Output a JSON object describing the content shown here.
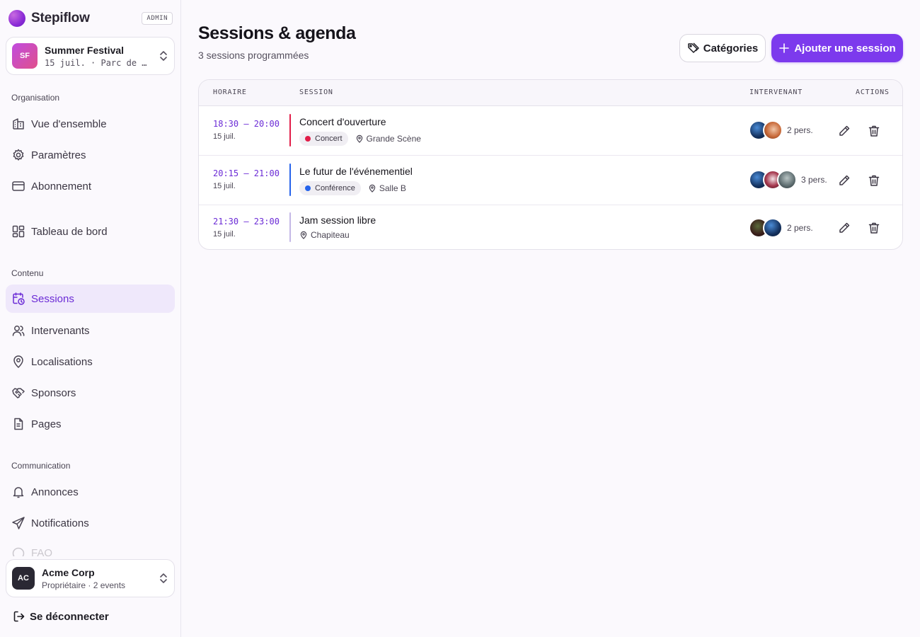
{
  "brand": {
    "name": "Stepiflow",
    "badge": "ADMIN"
  },
  "event": {
    "initials": "SF",
    "name": "Summer Festival",
    "subtitle": "15 juil. · Parc de …"
  },
  "nav": {
    "sections": {
      "organisation": "Organisation",
      "contenu": "Contenu",
      "communication": "Communication"
    },
    "items": {
      "overview": "Vue d'ensemble",
      "settings": "Paramètres",
      "subscription": "Abonnement",
      "dashboard": "Tableau de bord",
      "sessions": "Sessions",
      "speakers": "Intervenants",
      "locations": "Localisations",
      "sponsors": "Sponsors",
      "pages": "Pages",
      "announcements": "Annonces",
      "notifications": "Notifications",
      "faq": "FAQ"
    }
  },
  "org": {
    "initials": "AC",
    "name": "Acme Corp",
    "subtitle": "Propriétaire · 2 events"
  },
  "logout_label": "Se déconnecter",
  "page": {
    "title": "Sessions & agenda",
    "subtitle": "3 sessions programmées"
  },
  "buttons": {
    "categories": "Catégories",
    "add_session": "Ajouter une session"
  },
  "table": {
    "headers": {
      "time": "HORAIRE",
      "session": "SESSION",
      "speaker": "INTERVENANT",
      "actions": "ACTIONS"
    },
    "rows": [
      {
        "time": "18:30 – 20:00",
        "date": "15 juil.",
        "title": "Concert d'ouverture",
        "category": "Concert",
        "category_color": "#e11d48",
        "bar_color": "#e11d48",
        "location": "Grande Scène",
        "persons": "2 pers."
      },
      {
        "time": "20:15 – 21:00",
        "date": "15 juil.",
        "title": "Le futur de l'événementiel",
        "category": "Conférence",
        "category_color": "#2563eb",
        "bar_color": "#2563eb",
        "location": "Salle B",
        "persons": "3 pers."
      },
      {
        "time": "21:30 – 23:00",
        "date": "15 juil.",
        "title": "Jam session libre",
        "category": "",
        "category_color": "",
        "bar_color": "#c4b8e6",
        "location": "Chapiteau",
        "persons": "2 pers."
      }
    ]
  }
}
